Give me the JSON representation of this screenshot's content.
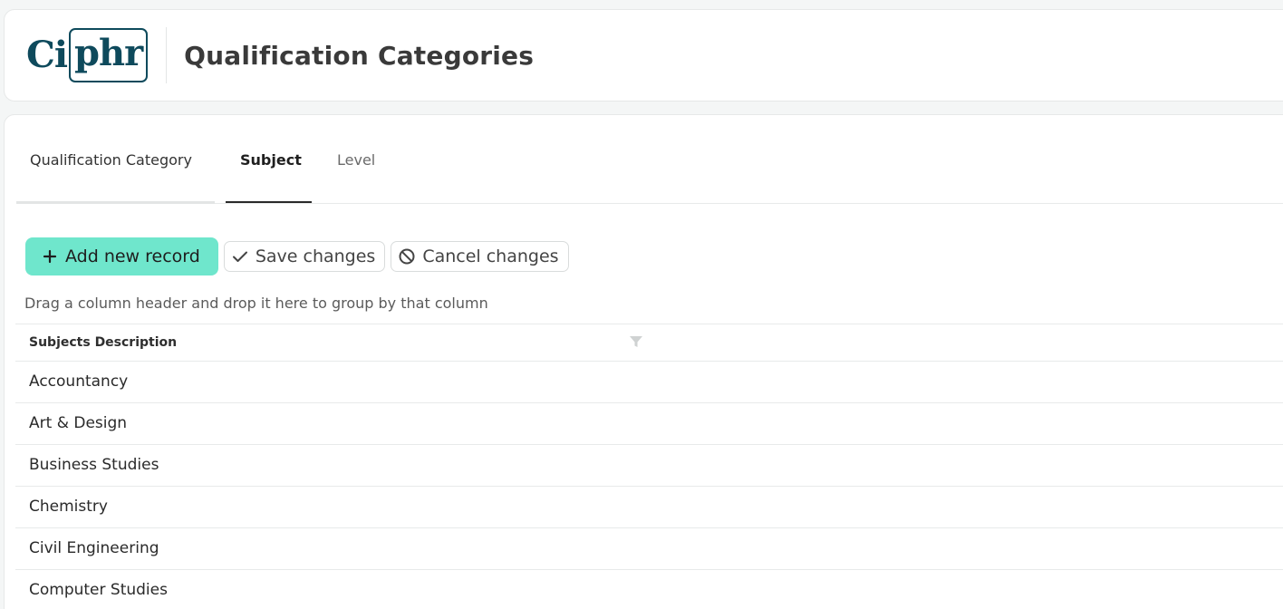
{
  "app": {
    "logo_letters": "Ci",
    "logo_boxed_letters": "phr",
    "page_title": "Qualification Categories"
  },
  "tabs": [
    {
      "label": "Qualification Category"
    },
    {
      "label": "Subject",
      "active": true
    },
    {
      "label": "Level"
    }
  ],
  "toolbar": {
    "add_label": "Add new record",
    "save_label": "Save changes",
    "cancel_label": "Cancel changes"
  },
  "group_hint": "Drag a column header and drop it here to group by that column",
  "grid": {
    "column_header": "Subjects Description",
    "rows": [
      "Accountancy",
      "Art & Design",
      "Business Studies",
      "Chemistry",
      "Civil Engineering",
      "Computer Studies"
    ]
  },
  "colors": {
    "brand": "#0e4a5c",
    "accent": "#6fe6cc"
  },
  "icons": {
    "add": "plus-icon",
    "save": "checkmark-icon",
    "cancel": "ban-icon",
    "filter": "filter-icon"
  }
}
